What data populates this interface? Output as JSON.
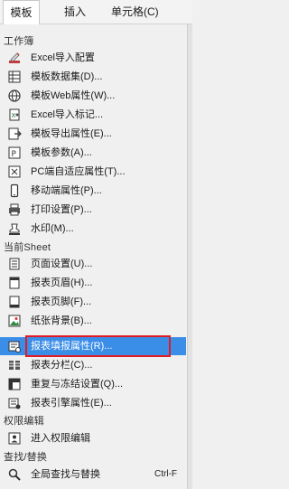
{
  "menubar": {
    "tabs": [
      {
        "label": "模板"
      },
      {
        "label": "插入"
      },
      {
        "label": "单元格(C)"
      }
    ]
  },
  "menu": {
    "sections": {
      "workbook": "工作簿",
      "current_sheet": "当前Sheet",
      "permission": "权限编辑",
      "find": "查找/替换"
    },
    "items": [
      {
        "label": "Excel导入配置",
        "icon": "excel-import-icon"
      },
      {
        "label": "模板数据集(D)...",
        "icon": "dataset-icon"
      },
      {
        "label": "模板Web属性(W)...",
        "icon": "web-globe-icon"
      },
      {
        "label": "Excel导入标记...",
        "icon": "excel-mark-icon"
      },
      {
        "label": "模板导出属性(E)...",
        "icon": "export-icon"
      },
      {
        "label": "模板参数(A)...",
        "icon": "parameter-icon"
      },
      {
        "label": "PC端自适应属性(T)...",
        "icon": "pc-adaptive-icon"
      },
      {
        "label": "移动端属性(P)...",
        "icon": "mobile-icon"
      },
      {
        "label": "打印设置(P)...",
        "icon": "printer-icon"
      },
      {
        "label": "水印(M)...",
        "icon": "watermark-icon"
      },
      {
        "label": "页面设置(U)...",
        "icon": "page-setup-icon"
      },
      {
        "label": "报表页眉(H)...",
        "icon": "header-icon"
      },
      {
        "label": "报表页脚(F)...",
        "icon": "footer-icon"
      },
      {
        "label": "纸张背景(B)...",
        "icon": "paper-background-icon"
      },
      {
        "label": "报表填报属性(R)...",
        "icon": "fill-attribute-icon"
      },
      {
        "label": "报表分栏(C)...",
        "icon": "columns-icon"
      },
      {
        "label": "重复与冻结设置(Q)...",
        "icon": "freeze-icon"
      },
      {
        "label": "报表引擎属性(E)...",
        "icon": "engine-icon"
      },
      {
        "label": "进入权限编辑",
        "icon": "permission-icon"
      },
      {
        "label": "全局查找与替换",
        "icon": "find-replace-icon",
        "shortcut": "Ctrl-F"
      }
    ]
  }
}
